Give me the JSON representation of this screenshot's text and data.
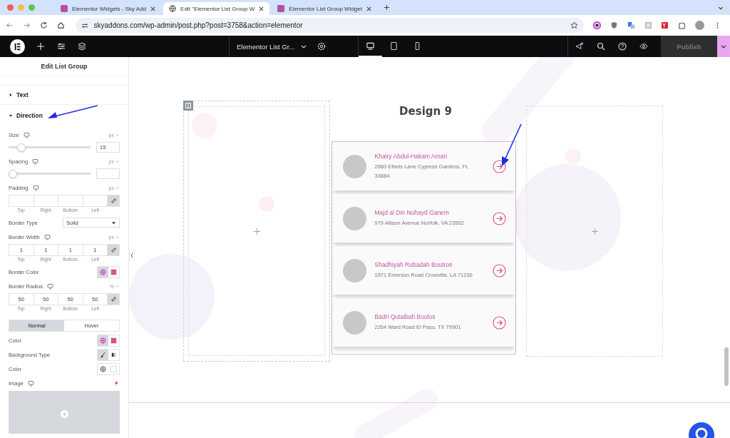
{
  "browser": {
    "tabs": [
      {
        "title": "Elementor Widgets - Sky Add",
        "kind": "sky",
        "selected": false
      },
      {
        "title": "Edit \"Elementor List Group W",
        "kind": "globe",
        "selected": true
      },
      {
        "title": "Elementor List Group Widget",
        "kind": "sky",
        "selected": false
      }
    ],
    "url": "skyaddons.com/wp-admin/post.php?post=3758&action=elementor"
  },
  "topbar": {
    "document": "Elementor List Gr...",
    "publish": "Publish",
    "devices": [
      {
        "kind": "desktop",
        "selected": true
      },
      {
        "kind": "tablet",
        "selected": false
      },
      {
        "kind": "mobile",
        "selected": false
      }
    ]
  },
  "panel": {
    "title": "Edit List Group",
    "sections": [
      {
        "label": "Text",
        "expanded": false
      },
      {
        "label": "Direction",
        "expanded": true,
        "controls": [
          {
            "kind": "slider",
            "label": "Size",
            "responsive": true,
            "unit": "px",
            "level": 0.12,
            "value": "15"
          },
          {
            "kind": "slider",
            "label": "Spacing",
            "responsive": true,
            "unit": "px",
            "level": 0
          },
          {
            "kind": "dimensions",
            "label": "Padding",
            "responsive": true,
            "unit": "px",
            "fields": [
              {
                "label": "Top"
              },
              {
                "label": "Right"
              },
              {
                "label": "Bottom"
              },
              {
                "label": "Left"
              }
            ]
          },
          {
            "kind": "select",
            "label": "Border Type",
            "value": "Solid"
          },
          {
            "kind": "dimensions",
            "label": "Border Width",
            "responsive": true,
            "unit": "px",
            "fields": [
              {
                "label": "Top",
                "value": "1"
              },
              {
                "label": "Right",
                "value": "1"
              },
              {
                "label": "Bottom",
                "value": "1"
              },
              {
                "label": "Left",
                "value": "1"
              }
            ]
          },
          {
            "kind": "color",
            "label": "Border Color",
            "global": true,
            "color": "#e0508a"
          },
          {
            "kind": "dimensions",
            "label": "Border Radius",
            "responsive": true,
            "unit": "%",
            "fields": [
              {
                "label": "Top",
                "value": "50"
              },
              {
                "label": "Right",
                "value": "50"
              },
              {
                "label": "Bottom",
                "value": "50"
              },
              {
                "label": "Left",
                "value": "50"
              }
            ]
          },
          {
            "kind": "tabs",
            "tabs": [
              {
                "label": "Normal",
                "selected": true
              },
              {
                "label": "Hover",
                "selected": false
              }
            ]
          },
          {
            "kind": "color",
            "label": "Color",
            "global": true,
            "color": "#e0508a"
          },
          {
            "kind": "choice",
            "label": "Background Type",
            "options": [
              {
                "kind": "classic",
                "selected": true
              },
              {
                "kind": "gradient",
                "selected": false
              }
            ]
          },
          {
            "kind": "color",
            "label": "Color",
            "global": false,
            "color": "#ffffff"
          },
          {
            "kind": "image",
            "label": "Image",
            "responsive": true
          }
        ]
      }
    ]
  },
  "canvas": {
    "heading": "Design 9",
    "items": [
      {
        "name": "Khairy Abdul-Hakam Amari",
        "address": "2680 Ethels Lane Cypress Gardens, FL 33884"
      },
      {
        "name": "Majd al Din Nuhayd Ganem",
        "address": "979 Allison Avenue Norfolk, VA 23502"
      },
      {
        "name": "Shadhiyah Rubadah Boutros",
        "address": "1571 Emerson Road Crowville, LA 71230"
      },
      {
        "name": "Badri Qutaibah Boulos",
        "address": "2264 Ward Road El Paso, TX 79901"
      }
    ]
  }
}
